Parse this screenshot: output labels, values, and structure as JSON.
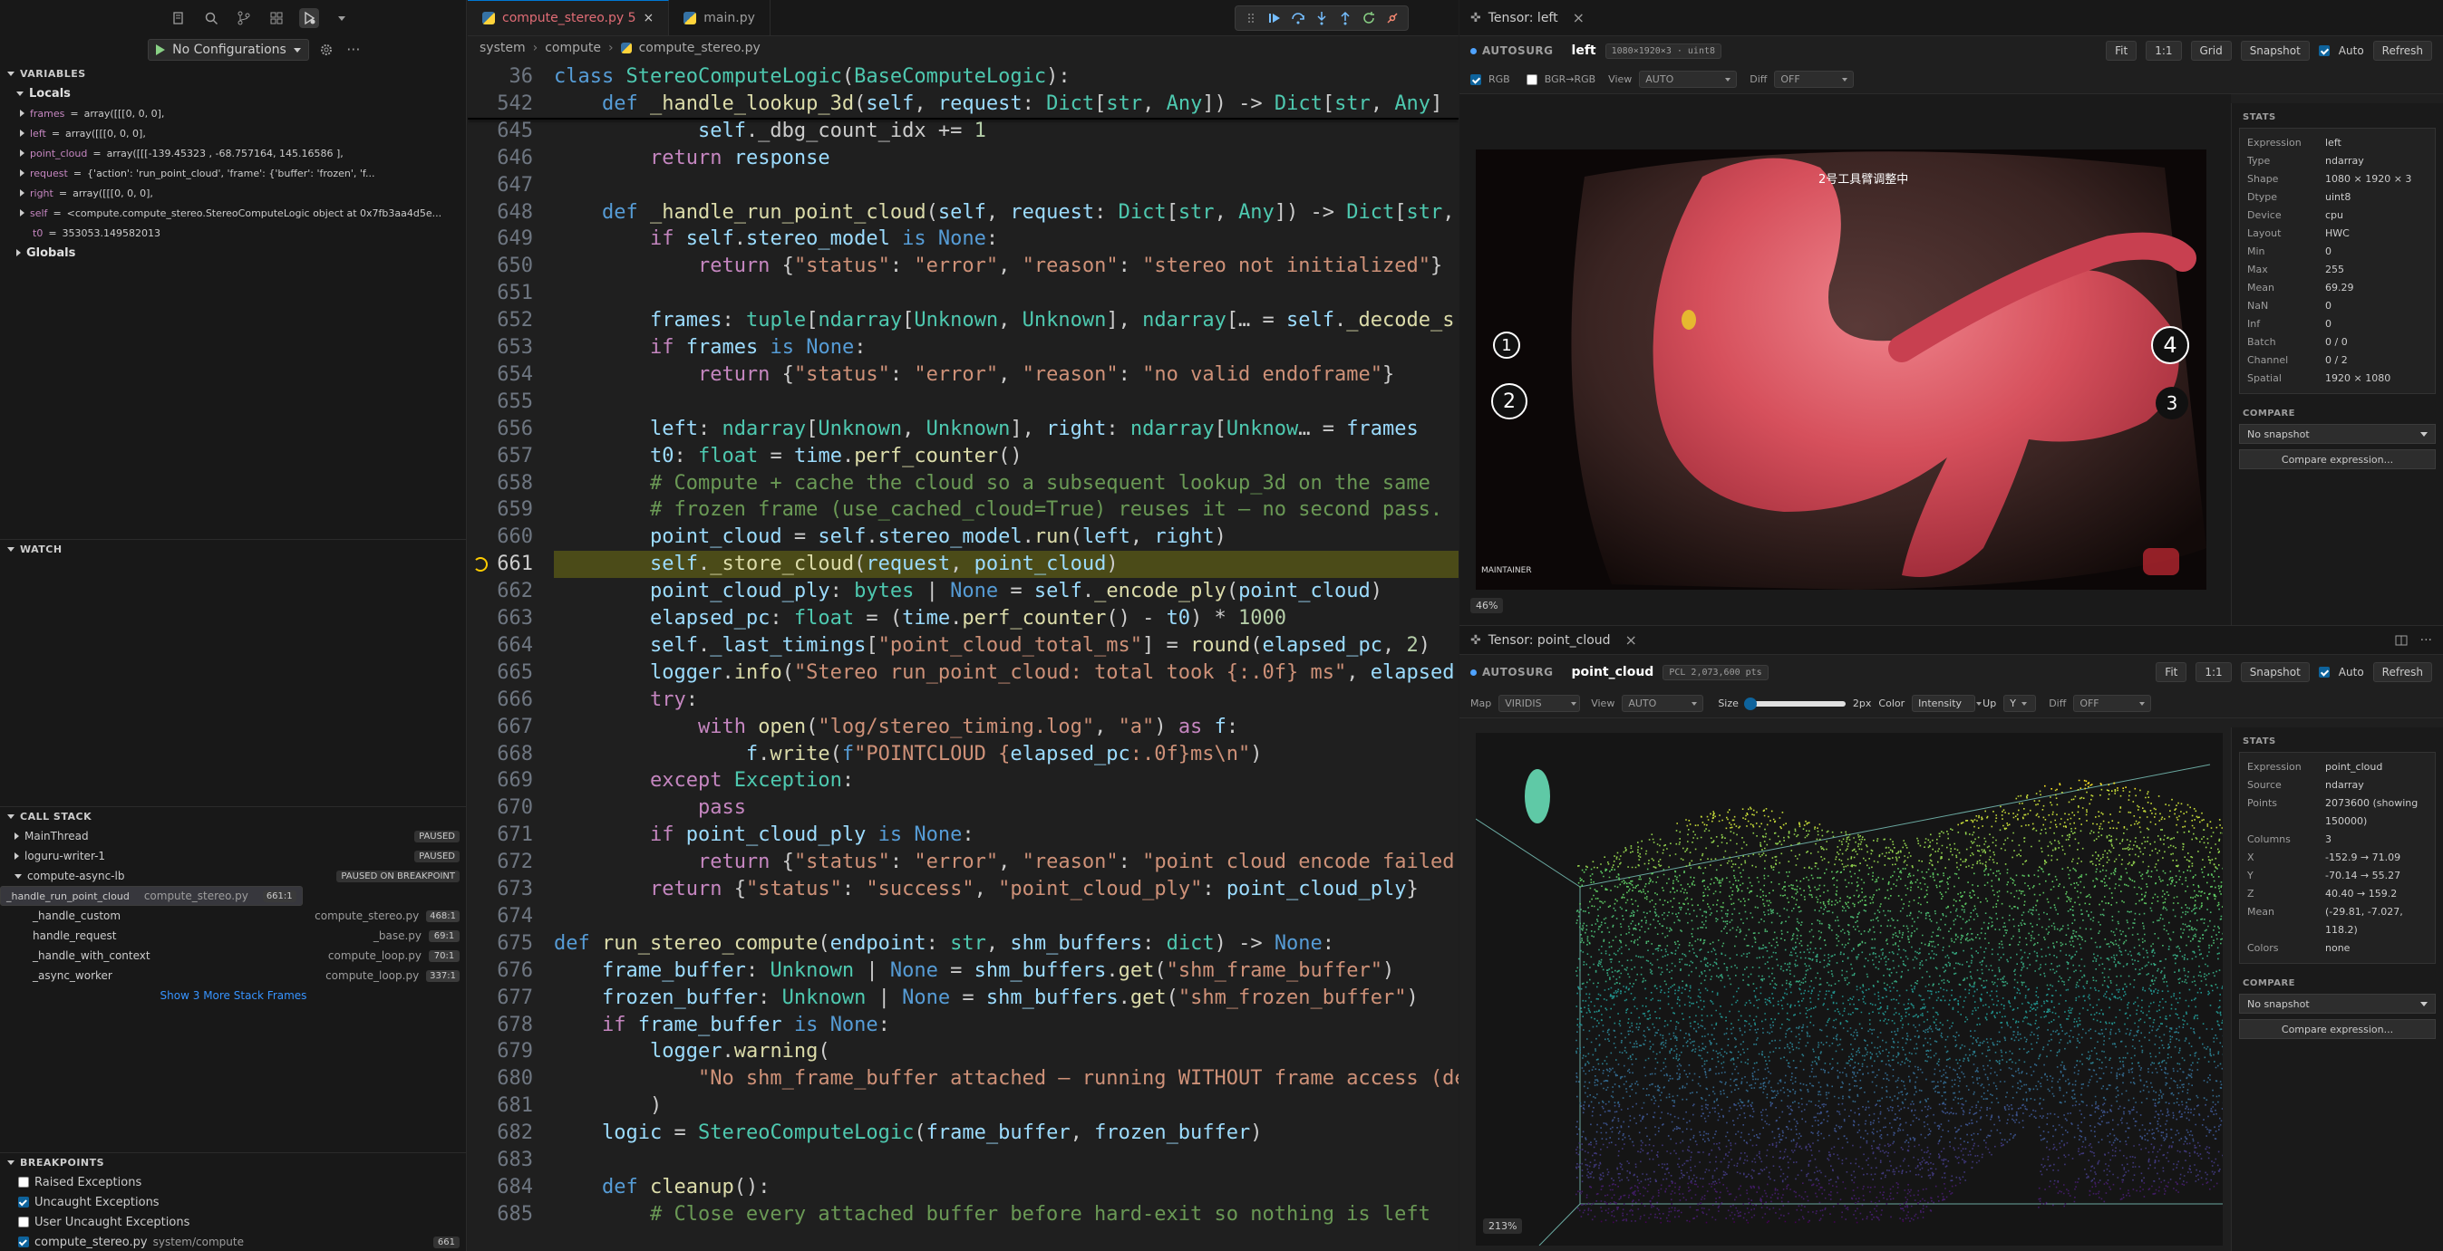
{
  "sidebar": {
    "run_config": "No Configurations",
    "variables_title": "VARIABLES",
    "locals_title": "Locals",
    "locals": [
      {
        "name": "frames",
        "value": "array([[[0, 0, 0],",
        "expandable": true
      },
      {
        "name": "left",
        "value": "array([[[0, 0, 0],",
        "expandable": true
      },
      {
        "name": "point_cloud",
        "value": "array([[[-139.45323 ,  -68.757164,  145.16586 ],",
        "expandable": true
      },
      {
        "name": "request",
        "value": "{'action': 'run_point_cloud', 'frame': {'buffer': 'frozen', 'f...",
        "expandable": true
      },
      {
        "name": "right",
        "value": "array([[[0, 0, 0],",
        "expandable": true
      },
      {
        "name": "self",
        "value": "<compute.compute_stereo.StereoComputeLogic object at 0x7fb3aa4d5e...",
        "expandable": true
      },
      {
        "name": "t0",
        "value": "353053.149582013",
        "expandable": false
      }
    ],
    "globals_title": "Globals",
    "watch_title": "WATCH",
    "callstack_title": "CALL STACK",
    "threads": [
      {
        "name": "MainThread",
        "badge": "PAUSED"
      },
      {
        "name": "loguru-writer-1",
        "badge": "PAUSED"
      },
      {
        "name": "compute-async-lb",
        "badge": "PAUSED ON BREAKPOINT"
      }
    ],
    "frames": [
      {
        "fn": "_handle_run_point_cloud",
        "file": "compute_stereo.py",
        "line": "661:1"
      },
      {
        "fn": "_handle_custom",
        "file": "compute_stereo.py",
        "line": "468:1"
      },
      {
        "fn": "handle_request",
        "file": "_base.py",
        "line": "69:1"
      },
      {
        "fn": "_handle_with_context",
        "file": "compute_loop.py",
        "line": "70:1"
      },
      {
        "fn": "_async_worker",
        "file": "compute_loop.py",
        "line": "337:1"
      }
    ],
    "more_frames": "Show 3 More Stack Frames",
    "breakpoints_title": "BREAKPOINTS",
    "breakpoints": [
      {
        "label": "Raised Exceptions",
        "checked": false
      },
      {
        "label": "Uncaught Exceptions",
        "checked": true
      },
      {
        "label": "User Uncaught Exceptions",
        "checked": false
      }
    ],
    "bp_file": {
      "name": "compute_stereo.py",
      "path": "system/compute",
      "line": "661"
    }
  },
  "editor": {
    "tabs": [
      {
        "label": "compute_stereo.py 5",
        "active": true
      },
      {
        "label": "main.py",
        "active": false
      }
    ],
    "breadcrumb": [
      "system",
      "compute",
      "compute_stereo.py"
    ]
  },
  "tensor_left": {
    "tab_title": "Tensor: left",
    "brand": "AUTOSURG",
    "name": "left",
    "meta": "1080×1920×3 · uint8",
    "buttons": [
      "Fit",
      "1:1",
      "Grid",
      "Snapshot"
    ],
    "auto_label": "Auto",
    "refresh": "Refresh",
    "rgb_label": "RGB",
    "bgr_label": "BGR→RGB",
    "view_label": "View",
    "view_value": "AUTO",
    "diff_label": "Diff",
    "diff_value": "OFF",
    "overlay_text": "2号工具臂调整中",
    "maintainer": "MAINTAINER",
    "markers": [
      "1",
      "2",
      "3",
      "4"
    ],
    "zoom": "46%",
    "stats_title": "STATS",
    "stats": [
      [
        "Expression",
        "left"
      ],
      [
        "Type",
        "ndarray"
      ],
      [
        "Shape",
        "1080 × 1920 × 3"
      ],
      [
        "Dtype",
        "uint8"
      ],
      [
        "Device",
        "cpu"
      ],
      [
        "Layout",
        "HWC"
      ],
      [
        "Min",
        "0"
      ],
      [
        "Max",
        "255"
      ],
      [
        "Mean",
        "69.29"
      ],
      [
        "NaN",
        "0"
      ],
      [
        "Inf",
        "0"
      ],
      [
        "Batch",
        "0 / 0"
      ],
      [
        "Channel",
        "0 / 2"
      ],
      [
        "Spatial",
        "1920 × 1080"
      ]
    ],
    "compare_title": "COMPARE",
    "compare_value": "No snapshot",
    "compare_btn": "Compare expression..."
  },
  "tensor_pc": {
    "tab_title": "Tensor: point_cloud",
    "brand": "AUTOSURG",
    "name": "point_cloud",
    "meta": "PCL 2,073,600 pts",
    "buttons": [
      "Fit",
      "1:1",
      "Snapshot"
    ],
    "auto_label": "Auto",
    "refresh": "Refresh",
    "map_label": "Map",
    "map_value": "VIRIDIS",
    "view_label": "View",
    "view_value": "AUTO",
    "size_label": "Size",
    "size_value": "2px",
    "color_label": "Color",
    "color_value": "Intensity",
    "up_label": "Up",
    "up_value": "Y",
    "diff_label": "Diff",
    "diff_value": "OFF",
    "zoom": "213%",
    "stats_title": "STATS",
    "stats": [
      [
        "Expression",
        "point_cloud"
      ],
      [
        "Source",
        "ndarray"
      ],
      [
        "Points",
        "2073600 (showing 150000)"
      ],
      [
        "Columns",
        "3"
      ],
      [
        "X",
        "-152.9 → 71.09"
      ],
      [
        "Y",
        "-70.14 → 55.27"
      ],
      [
        "Z",
        "40.40 → 159.2"
      ],
      [
        "Mean",
        "(-29.81, -7.027, 118.2)"
      ],
      [
        "Colors",
        "none"
      ]
    ],
    "compare_title": "COMPARE",
    "compare_value": "No snapshot",
    "compare_btn": "Compare expression..."
  }
}
